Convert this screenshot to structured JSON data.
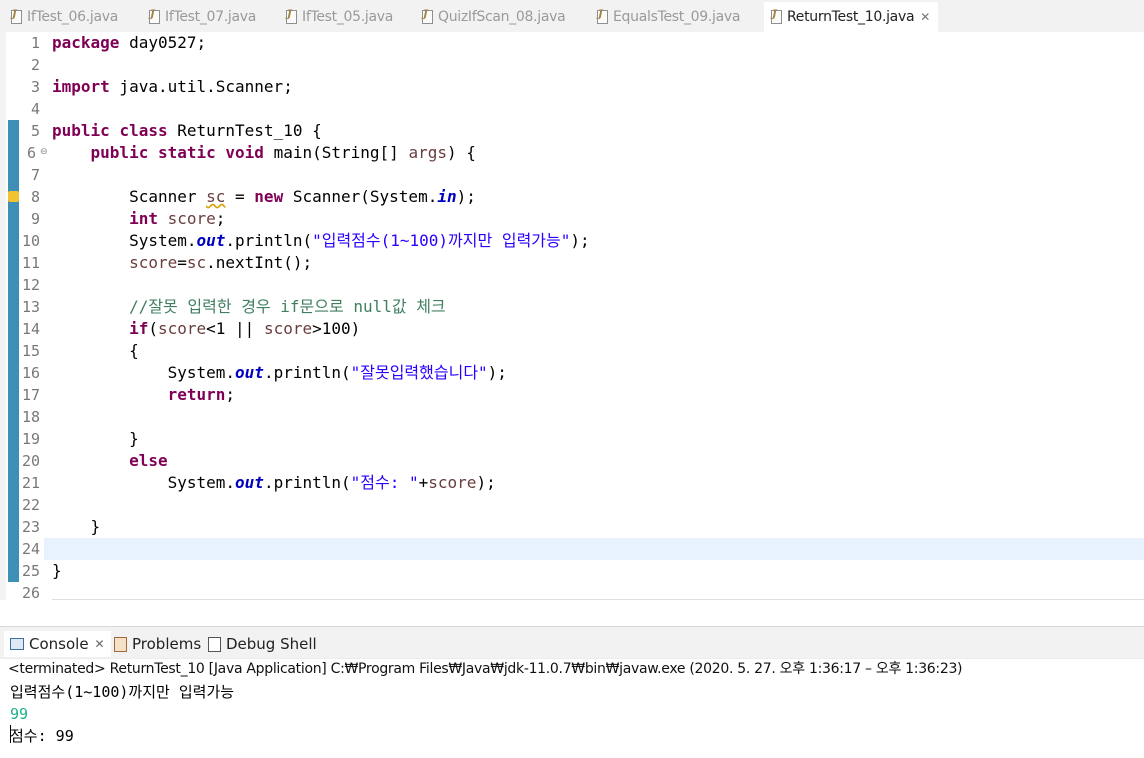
{
  "tabs": [
    {
      "label": "IfTest_06.java",
      "active": false
    },
    {
      "label": "IfTest_07.java",
      "active": false
    },
    {
      "label": "IfTest_05.java",
      "active": false
    },
    {
      "label": "QuizIfScan_08.java",
      "active": false
    },
    {
      "label": "EqualsTest_09.java",
      "active": false
    },
    {
      "label": "ReturnTest_10.java",
      "active": true
    }
  ],
  "editor": {
    "line_numbers": [
      "1",
      "2",
      "3",
      "4",
      "5",
      "6",
      "7",
      "8",
      "9",
      "10",
      "11",
      "12",
      "13",
      "14",
      "15",
      "16",
      "17",
      "18",
      "19",
      "20",
      "21",
      "22",
      "23",
      "24",
      "25",
      "26"
    ],
    "current_line": 24,
    "code": {
      "l1_kw": "package",
      "l1_rest": " day0527;",
      "l3_kw": "import",
      "l3_rest": " java.util.Scanner;",
      "l5_kw1": "public",
      "l5_kw2": "class",
      "l5_rest": " ReturnTest_10 {",
      "l6_kw1": "public",
      "l6_kw2": "static",
      "l6_kw3": "void",
      "l6_rest1": " main(String[] ",
      "l6_var": "args",
      "l6_rest2": ") {",
      "l8_a": "Scanner ",
      "l8_var": "sc",
      "l8_b": " = ",
      "l8_kw": "new",
      "l8_c": " Scanner(System.",
      "l8_fld": "in",
      "l8_d": ");",
      "l9_kw": "int",
      "l9_var": " score",
      "l9_rest": ";",
      "l10_a": "System.",
      "l10_fld": "out",
      "l10_b": ".println(",
      "l10_str": "\"입력점수(1~100)까지만 입력가능\"",
      "l10_c": ");",
      "l11_var1": "score",
      "l11_a": "=",
      "l11_var2": "sc",
      "l11_b": ".nextInt();",
      "l13_cmt": "//잘못 입력한 경우 if문으로 null값 체크",
      "l14_kw": "if",
      "l14_a": "(",
      "l14_var1": "score",
      "l14_b": "<1 || ",
      "l14_var2": "score",
      "l14_c": ">100)",
      "l15": "{",
      "l16_a": "System.",
      "l16_fld": "out",
      "l16_b": ".println(",
      "l16_str": "\"잘못입력했습니다\"",
      "l16_c": ");",
      "l17_kw": "return",
      "l17_rest": ";",
      "l19": "}",
      "l20_kw": "else",
      "l21_a": "System.",
      "l21_fld": "out",
      "l21_b": ".println(",
      "l21_str": "\"점수: \"",
      "l21_c": "+",
      "l21_var": "score",
      "l21_d": ");",
      "l23": "}",
      "l25": "}"
    }
  },
  "views": {
    "tabs": [
      {
        "label": "Console",
        "active": true
      },
      {
        "label": "Problems",
        "active": false
      },
      {
        "label": "Debug Shell",
        "active": false
      }
    ],
    "console_header": "<terminated> ReturnTest_10 [Java Application] C:₩Program Files₩Java₩jdk-11.0.7₩bin₩javaw.exe  (2020. 5. 27. 오후 1:36:17 – 오후 1:36:23)",
    "output": {
      "line1": "입력점수(1~100)까지만 입력가능",
      "input": "99",
      "line3": "점수: 99"
    }
  },
  "colors": {
    "keyword": "#7f0055",
    "string": "#2a00ff",
    "comment": "#3f7f5f",
    "field": "#0000c0",
    "console_input": "#19b38a",
    "current_line_bg": "#e8f2fe"
  }
}
